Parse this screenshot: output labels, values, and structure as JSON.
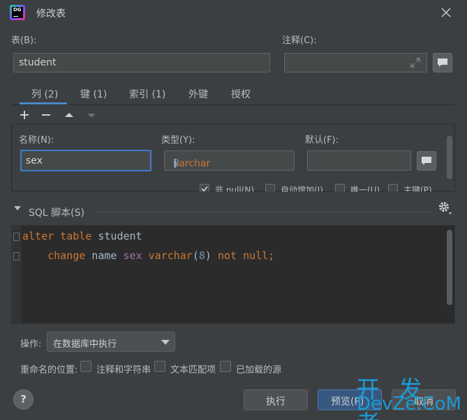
{
  "window": {
    "title": "修改表"
  },
  "table_field": {
    "label": "表(B):",
    "value": "student"
  },
  "comment_field": {
    "label": "注释(C):",
    "value": ""
  },
  "tabs": [
    {
      "label": "列 (2)"
    },
    {
      "label": "键 (1)"
    },
    {
      "label": "索引 (1)"
    },
    {
      "label": "外键"
    },
    {
      "label": "授权"
    }
  ],
  "column": {
    "name_label": "名称(N):",
    "name_value": "sex",
    "type_label": "类型(Y):",
    "type_name": "varchar",
    "type_paren_open": "(",
    "type_length": "8",
    "type_paren_close": ")",
    "default_label": "默认(F):",
    "default_value": "",
    "options": [
      {
        "label": "非 null(N)",
        "checked": true
      },
      {
        "label": "自动增加(I)",
        "checked": false
      },
      {
        "label": "唯一(U)",
        "checked": false
      },
      {
        "label": "主键(P)",
        "checked": false
      }
    ]
  },
  "sql": {
    "title": "SQL 脚本(S)",
    "line1": {
      "kw": "alter table",
      "table": "student"
    },
    "line2": {
      "kw": "change",
      "old": "name",
      "new": "sex",
      "type": "varchar",
      "len": "8",
      "tail": "not null;"
    }
  },
  "operation": {
    "label": "操作:",
    "selected": "在数据库中执行"
  },
  "rename": {
    "label": "重命名的位置:",
    "options": [
      "注释和字符串",
      "文本匹配项",
      "已加载的源"
    ]
  },
  "buttons": {
    "help": "?",
    "execute": "执行",
    "preview": "预览(P)",
    "cancel": "取消"
  },
  "watermark": {
    "line1": "开 发 者",
    "line2": "DevZe.CoM"
  },
  "colors": {
    "accent": "#4a88c7",
    "keyword": "#cc7832",
    "number": "#6897bb",
    "column": "#9876aa"
  }
}
